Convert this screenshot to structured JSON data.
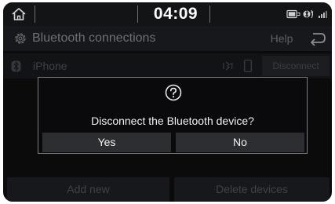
{
  "status_bar": {
    "time": "04:09",
    "icons": [
      "home-icon",
      "phone-battery-icon",
      "bluetooth-audio-icon",
      "signal-icon"
    ]
  },
  "title_bar": {
    "title": "Bluetooth connections",
    "help_label": "Help",
    "icons": [
      "gear-icon",
      "back-arrow-icon"
    ]
  },
  "device_row": {
    "name": "iPhone",
    "disconnect_label": "Disconnect",
    "icons": [
      "bluetooth-icon",
      "bluetooth-audio-icon",
      "phone-icon"
    ]
  },
  "bottom_buttons": {
    "add_new_label": "Add new",
    "delete_label": "Delete devices"
  },
  "dialog": {
    "icon": "question-icon",
    "message": "Disconnect the Bluetooth device?",
    "yes_label": "Yes",
    "no_label": "No"
  },
  "colors": {
    "screen_bg": "#0b0b0c",
    "bar_bg": "#17181b",
    "dialog_border": "#7c7e82",
    "button_bg": "#2d2e31",
    "text": "#f2f2f2",
    "dim_text": "#6e7076"
  }
}
